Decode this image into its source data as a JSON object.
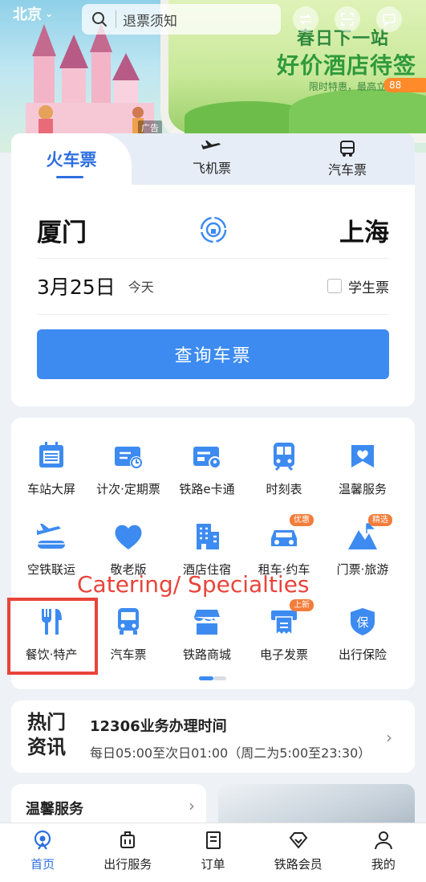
{
  "banner": {
    "ad_label": "广告",
    "promo_line1": "春日下一站",
    "promo_line2": "好价酒店待签",
    "promo_line3": "限时特惠，最高立减",
    "promo_amount": "88"
  },
  "topbar": {
    "city": "北京",
    "search_placeholder": "退票须知"
  },
  "ticket": {
    "tabs": [
      {
        "label": "火车票",
        "active": true
      },
      {
        "label": "飞机票",
        "active": false
      },
      {
        "label": "汽车票",
        "active": false
      }
    ],
    "from_station": "厦门",
    "to_station": "上海",
    "date": "3月25日",
    "date_hint": "今天",
    "student_label": "学生票",
    "student_checked": false,
    "query_button": "查询车票"
  },
  "services": [
    {
      "label": "车站大屏",
      "icon": "station-screen-icon"
    },
    {
      "label": "计次·定期票",
      "icon": "ticket-card-icon"
    },
    {
      "label": "铁路e卡通",
      "icon": "ecard-icon"
    },
    {
      "label": "时刻表",
      "icon": "timetable-icon"
    },
    {
      "label": "温馨服务",
      "icon": "warm-service-icon"
    },
    {
      "label": "空铁联运",
      "icon": "air-rail-icon"
    },
    {
      "label": "敬老版",
      "icon": "heart-icon"
    },
    {
      "label": "酒店住宿",
      "icon": "hotel-icon"
    },
    {
      "label": "租车·约车",
      "icon": "car-icon",
      "badge": "优惠"
    },
    {
      "label": "门票·旅游",
      "icon": "mountain-icon",
      "badge": "精选"
    },
    {
      "label": "餐饮·特产",
      "icon": "fork-knife-icon"
    },
    {
      "label": "汽车票",
      "icon": "bus-icon"
    },
    {
      "label": "铁路商城",
      "icon": "shop-icon"
    },
    {
      "label": "电子发票",
      "icon": "invoice-icon",
      "badge": "上新"
    },
    {
      "label": "出行保险",
      "icon": "insurance-icon"
    }
  ],
  "annotation": "Catering/ Specialties",
  "news": {
    "logo": "热门资讯",
    "title": "12306业务办理时间",
    "body": "每日05:00至次日01:00（周二为5:00至23:30）"
  },
  "warm_service": {
    "title": "温馨服务"
  },
  "nav": [
    {
      "label": "首页",
      "active": true
    },
    {
      "label": "出行服务",
      "active": false
    },
    {
      "label": "订单",
      "active": false
    },
    {
      "label": "铁路会员",
      "active": false
    },
    {
      "label": "我的",
      "active": false
    }
  ],
  "colors": {
    "primary": "#3d8bf0",
    "tab_active": "#2f6fe0",
    "annotation": "#e8443a",
    "badge": "#f37c3a"
  }
}
